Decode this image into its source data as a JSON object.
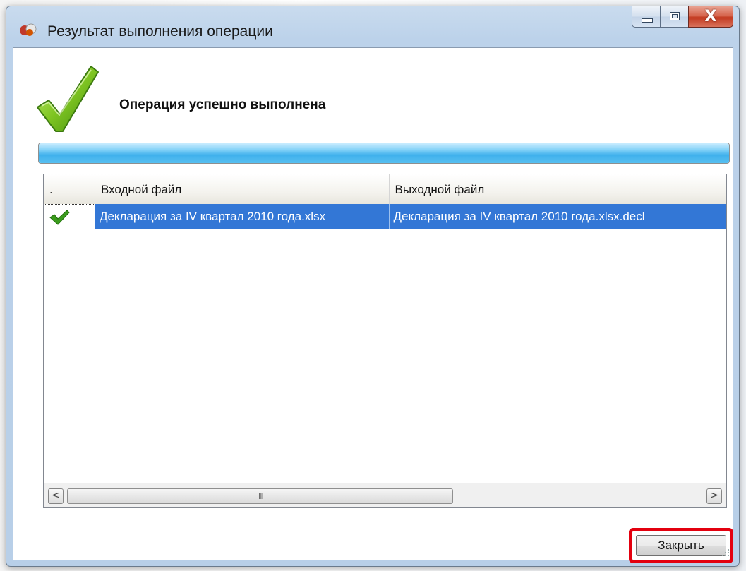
{
  "window": {
    "title": "Результат выполнения операции",
    "icons": {
      "app": "app-icon",
      "minimize": "minimize-icon",
      "maximize": "maximize-icon",
      "close": "close-icon"
    },
    "close_glyph": "X"
  },
  "status": {
    "icon": "success-check-icon",
    "message": "Операция успешно выполнена",
    "progress_fraction": 1.0
  },
  "grid": {
    "columns": [
      ".",
      "Входной файл",
      "Выходной файл"
    ],
    "rows": [
      {
        "status_icon": "check-icon",
        "input_file": "Декларация за IV квартал 2010 года.xlsx",
        "output_file": "Декларация за IV квартал 2010 года.xlsx.decl"
      }
    ],
    "scroll": {
      "left_glyph": "<",
      "right_glyph": ">",
      "grip": "III"
    }
  },
  "actions": {
    "close_label": "Закрыть"
  },
  "colors": {
    "selection": "#3377d6",
    "highlight": "#e3000f",
    "progress": "#3fb0ec"
  }
}
